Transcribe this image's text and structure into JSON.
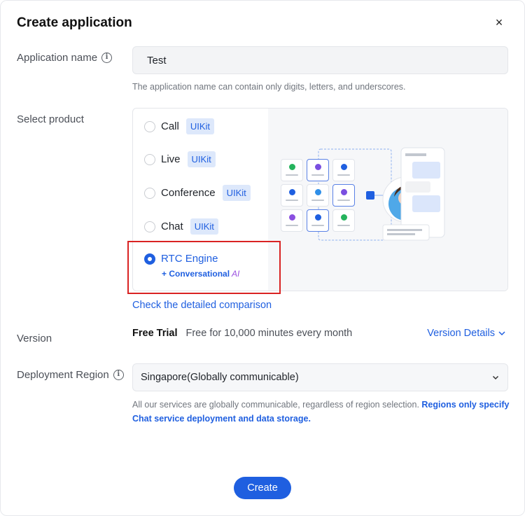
{
  "dialog": {
    "title": "Create application",
    "close_glyph": "×"
  },
  "app_name": {
    "label": "Application name",
    "value": "Test",
    "hint": "The application name can contain only digits, letters, and underscores."
  },
  "product": {
    "label": "Select product",
    "options": [
      {
        "label": "Call",
        "tag": "UIKit",
        "selected": false
      },
      {
        "label": "Live",
        "tag": "UIKit",
        "selected": false
      },
      {
        "label": "Conference",
        "tag": "UIKit",
        "selected": false
      },
      {
        "label": "Chat",
        "tag": "UIKit",
        "selected": false
      },
      {
        "label": "RTC Engine",
        "tag": "",
        "selected": true
      }
    ],
    "rtc_extra": "+ Conversational",
    "rtc_extra_ai": "AI",
    "compare_link": "Check the detailed comparison"
  },
  "version": {
    "label": "Version",
    "plan": "Free Trial",
    "plan_desc": "Free for 10,000 minutes every month",
    "details_link": "Version Details"
  },
  "region": {
    "label": "Deployment Region",
    "selected": "Singapore(Globally communicable)",
    "note_plain": "All our services are globally communicable, regardless of region selection. ",
    "note_bold": "Regions only specify Chat service deployment and data storage."
  },
  "actions": {
    "create_label": "Create"
  },
  "colors": {
    "accent": "#1f5fe0",
    "tag_bg": "#dde8fb",
    "highlight_box": "#d92323"
  }
}
